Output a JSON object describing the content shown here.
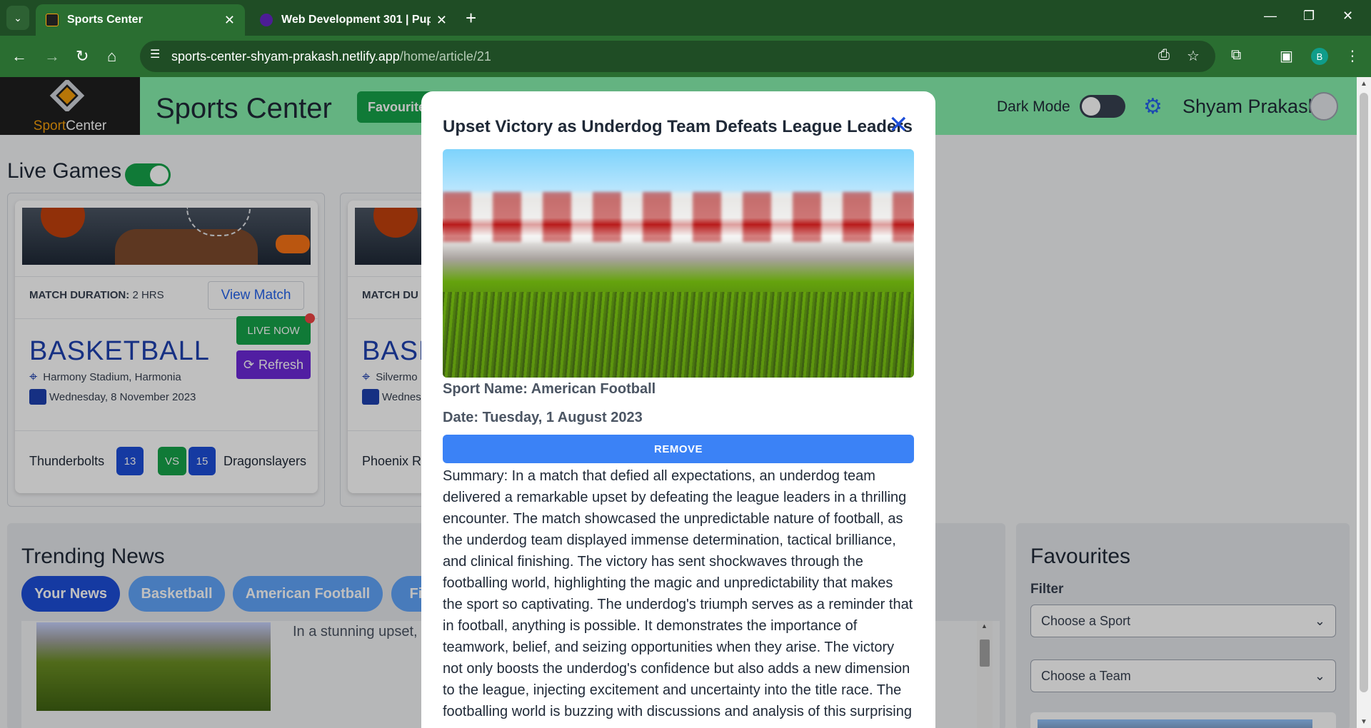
{
  "browser": {
    "tabs": [
      {
        "title": "Sports Center",
        "active": true
      },
      {
        "title": "Web Development 301 | Pupilfi",
        "active": false
      }
    ],
    "url_host": "sports-center-shyam-prakash.netlify.app",
    "url_path": "/home/article/21",
    "profile_initial": "B"
  },
  "header": {
    "logo_sport": "Sport",
    "logo_center": "Center",
    "site_title": "Sports Center",
    "favourites_button": "Favourite",
    "dark_mode_label": "Dark Mode",
    "user_name": "Shyam Prakash"
  },
  "live_games": {
    "title": "Live Games",
    "cards": [
      {
        "duration_label": "MATCH DURATION:",
        "duration_value": "2 HRS",
        "view_button": "View Match",
        "sport": "BASKETBALL",
        "location": "Harmony Stadium, Harmonia",
        "date": "Wednesday, 8 November 2023",
        "live_badge": "LIVE NOW",
        "refresh_button": "Refresh",
        "team_a": "Thunderbolts",
        "score_a": "13",
        "vs": "VS",
        "score_b": "15",
        "team_b": "Dragonslayers"
      },
      {
        "duration_label": "MATCH DU",
        "sport": "BASK",
        "location": "Silvermo",
        "date": "Wednes",
        "team_a": "Phoenix Ri"
      }
    ]
  },
  "trending": {
    "title": "Trending News",
    "tabs": [
      "Your News",
      "Basketball",
      "American Football",
      "Fie"
    ],
    "snippet": "In a stunning upset, a shockwaves through t"
  },
  "favourites": {
    "title": "Favourites",
    "filter_label": "Filter",
    "sport_select": "Choose a Sport",
    "team_select": "Choose a Team"
  },
  "modal": {
    "title": "Upset Victory as Underdog Team Defeats League Leaders",
    "sport_line": "Sport Name: American Football",
    "date_line": "Date: Tuesday, 1 August 2023",
    "remove_button": "REMOVE",
    "summary": "Summary: In a match that defied all expectations, an underdog team delivered a remarkable upset by defeating the league leaders in a thrilling encounter. The match showcased the unpredictable nature of football, as the underdog team displayed immense determination, tactical brilliance, and clinical finishing. The victory has sent shockwaves through the footballing world, highlighting the magic and unpredictability that makes the sport so captivating. The underdog's triumph serves as a reminder that in football, anything is possible. It demonstrates the importance of teamwork, belief, and seizing opportunities when they arise. The victory not only boosts the underdog's confidence but also adds a new dimension to the league, injecting excitement and uncertainty into the title race. The footballing world is buzzing with discussions and analysis of this surprising"
  },
  "icons": {
    "close": "close-icon",
    "gear": "gear-icon",
    "pin": "map-pin-icon",
    "calendar": "calendar-icon",
    "refresh": "refresh-icon"
  }
}
